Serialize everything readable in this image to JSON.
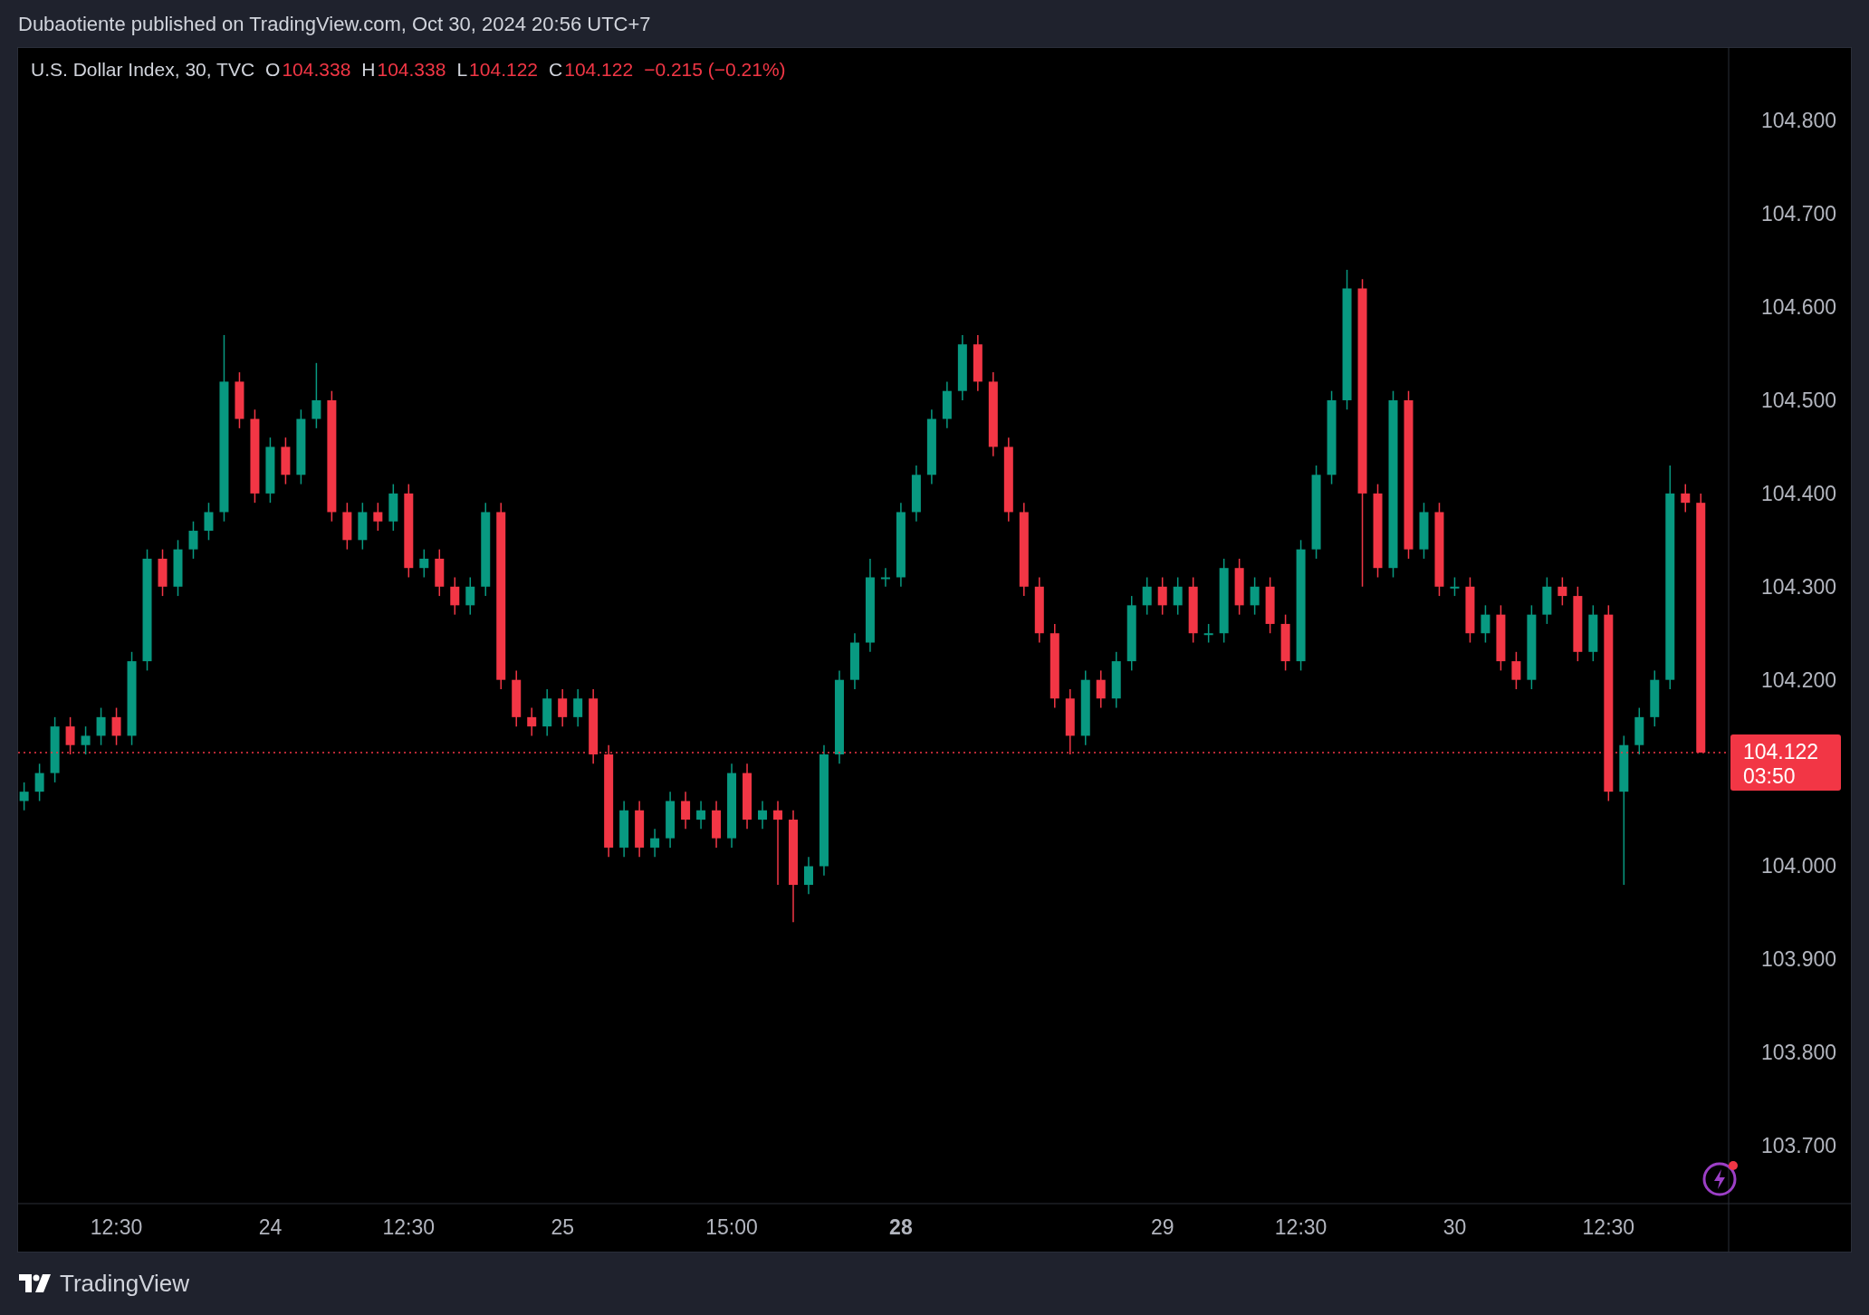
{
  "header": {
    "text": "Dubaotiente published on TradingView.com, Oct 30, 2024 20:56 UTC+7"
  },
  "chart": {
    "legend": {
      "symbol": "U.S. Dollar Index, 30, TVC",
      "fields": [
        {
          "label": "O",
          "value": "104.338"
        },
        {
          "label": "H",
          "value": "104.338"
        },
        {
          "label": "L",
          "value": "104.122"
        },
        {
          "label": "C",
          "value": "104.122"
        }
      ],
      "change": "−0.215 (−0.21%)"
    },
    "last_price": {
      "countdown": "03:50"
    },
    "bold_ticks": [
      false,
      false,
      false,
      false,
      false,
      true,
      false,
      false,
      false,
      false
    ],
    "chart_data": {
      "type": "candlestick",
      "ylim": [
        103.638,
        104.878
      ],
      "yticks": [
        {
          "value": 104.8,
          "label": "104.800"
        },
        {
          "value": 104.7,
          "label": "104.700"
        },
        {
          "value": 104.6,
          "label": "104.600"
        },
        {
          "value": 104.5,
          "label": "104.500"
        },
        {
          "value": 104.4,
          "label": "104.400"
        },
        {
          "value": 104.3,
          "label": "104.300"
        },
        {
          "value": 104.2,
          "label": "104.200"
        },
        {
          "value": 104.0,
          "label": "104.000"
        },
        {
          "value": 103.9,
          "label": "103.900"
        },
        {
          "value": 103.8,
          "label": "103.800"
        },
        {
          "value": 103.7,
          "label": "103.700"
        }
      ],
      "ref_lines": [
        {
          "axis": "y",
          "value": 104.122,
          "label": "104.122",
          "color": "#f23645"
        }
      ],
      "categories": [
        null,
        null,
        null,
        null,
        null,
        null,
        "12:30",
        null,
        null,
        null,
        null,
        null,
        null,
        null,
        null,
        null,
        "24",
        null,
        null,
        null,
        null,
        null,
        null,
        null,
        null,
        "12:30",
        null,
        null,
        null,
        null,
        null,
        null,
        null,
        null,
        null,
        "25",
        null,
        null,
        null,
        null,
        null,
        null,
        null,
        null,
        null,
        null,
        "15:00",
        null,
        null,
        null,
        null,
        null,
        null,
        null,
        null,
        null,
        null,
        "28",
        null,
        null,
        null,
        null,
        null,
        null,
        null,
        null,
        null,
        null,
        null,
        null,
        null,
        null,
        null,
        null,
        "29",
        null,
        null,
        null,
        null,
        null,
        null,
        null,
        null,
        "12:30",
        null,
        null,
        null,
        null,
        null,
        null,
        null,
        null,
        null,
        "30",
        null,
        null,
        null,
        null,
        null,
        null,
        null,
        null,
        null,
        "12:30",
        null,
        null,
        null,
        null,
        null,
        null
      ],
      "ohlc": [
        [
          104.07,
          104.09,
          104.06,
          104.08
        ],
        [
          104.08,
          104.11,
          104.07,
          104.1
        ],
        [
          104.1,
          104.16,
          104.09,
          104.15
        ],
        [
          104.15,
          104.16,
          104.12,
          104.13
        ],
        [
          104.13,
          104.15,
          104.12,
          104.14
        ],
        [
          104.14,
          104.17,
          104.13,
          104.16
        ],
        [
          104.16,
          104.17,
          104.13,
          104.14
        ],
        [
          104.14,
          104.23,
          104.13,
          104.22
        ],
        [
          104.22,
          104.34,
          104.21,
          104.33
        ],
        [
          104.33,
          104.34,
          104.29,
          104.3
        ],
        [
          104.3,
          104.35,
          104.29,
          104.34
        ],
        [
          104.34,
          104.37,
          104.33,
          104.36
        ],
        [
          104.36,
          104.39,
          104.35,
          104.38
        ],
        [
          104.38,
          104.57,
          104.37,
          104.52
        ],
        [
          104.52,
          104.53,
          104.47,
          104.48
        ],
        [
          104.48,
          104.49,
          104.39,
          104.4
        ],
        [
          104.4,
          104.46,
          104.39,
          104.45
        ],
        [
          104.45,
          104.46,
          104.41,
          104.42
        ],
        [
          104.42,
          104.49,
          104.41,
          104.48
        ],
        [
          104.48,
          104.54,
          104.47,
          104.5
        ],
        [
          104.5,
          104.51,
          104.37,
          104.38
        ],
        [
          104.38,
          104.39,
          104.34,
          104.35
        ],
        [
          104.35,
          104.39,
          104.34,
          104.38
        ],
        [
          104.38,
          104.39,
          104.36,
          104.37
        ],
        [
          104.37,
          104.41,
          104.36,
          104.4
        ],
        [
          104.4,
          104.41,
          104.31,
          104.32
        ],
        [
          104.32,
          104.34,
          104.31,
          104.33
        ],
        [
          104.33,
          104.34,
          104.29,
          104.3
        ],
        [
          104.3,
          104.31,
          104.27,
          104.28
        ],
        [
          104.28,
          104.31,
          104.27,
          104.3
        ],
        [
          104.3,
          104.39,
          104.29,
          104.38
        ],
        [
          104.38,
          104.39,
          104.19,
          104.2
        ],
        [
          104.2,
          104.21,
          104.15,
          104.16
        ],
        [
          104.16,
          104.17,
          104.14,
          104.15
        ],
        [
          104.15,
          104.19,
          104.14,
          104.18
        ],
        [
          104.18,
          104.19,
          104.15,
          104.16
        ],
        [
          104.16,
          104.19,
          104.15,
          104.18
        ],
        [
          104.18,
          104.19,
          104.11,
          104.12
        ],
        [
          104.12,
          104.13,
          104.01,
          104.02
        ],
        [
          104.02,
          104.07,
          104.01,
          104.06
        ],
        [
          104.06,
          104.07,
          104.01,
          104.02
        ],
        [
          104.02,
          104.04,
          104.01,
          104.03
        ],
        [
          104.03,
          104.08,
          104.02,
          104.07
        ],
        [
          104.07,
          104.08,
          104.04,
          104.05
        ],
        [
          104.05,
          104.07,
          104.04,
          104.06
        ],
        [
          104.06,
          104.07,
          104.02,
          104.03
        ],
        [
          104.03,
          104.11,
          104.02,
          104.1
        ],
        [
          104.1,
          104.11,
          104.04,
          104.05
        ],
        [
          104.05,
          104.07,
          104.04,
          104.06
        ],
        [
          104.06,
          104.07,
          103.98,
          104.05
        ],
        [
          104.05,
          104.06,
          103.94,
          103.98
        ],
        [
          103.98,
          104.01,
          103.97,
          104.0
        ],
        [
          104.0,
          104.13,
          103.99,
          104.12
        ],
        [
          104.12,
          104.21,
          104.11,
          104.2
        ],
        [
          104.2,
          104.25,
          104.19,
          104.24
        ],
        [
          104.24,
          104.33,
          104.23,
          104.31
        ],
        [
          104.31,
          104.32,
          104.3,
          104.31
        ],
        [
          104.31,
          104.39,
          104.3,
          104.38
        ],
        [
          104.38,
          104.43,
          104.37,
          104.42
        ],
        [
          104.42,
          104.49,
          104.41,
          104.48
        ],
        [
          104.48,
          104.52,
          104.47,
          104.51
        ],
        [
          104.51,
          104.57,
          104.5,
          104.56
        ],
        [
          104.56,
          104.57,
          104.51,
          104.52
        ],
        [
          104.52,
          104.53,
          104.44,
          104.45
        ],
        [
          104.45,
          104.46,
          104.37,
          104.38
        ],
        [
          104.38,
          104.39,
          104.29,
          104.3
        ],
        [
          104.3,
          104.31,
          104.24,
          104.25
        ],
        [
          104.25,
          104.26,
          104.17,
          104.18
        ],
        [
          104.18,
          104.19,
          104.12,
          104.14
        ],
        [
          104.14,
          104.21,
          104.13,
          104.2
        ],
        [
          104.2,
          104.21,
          104.17,
          104.18
        ],
        [
          104.18,
          104.23,
          104.17,
          104.22
        ],
        [
          104.22,
          104.29,
          104.21,
          104.28
        ],
        [
          104.28,
          104.31,
          104.27,
          104.3
        ],
        [
          104.3,
          104.31,
          104.27,
          104.28
        ],
        [
          104.28,
          104.31,
          104.27,
          104.3
        ],
        [
          104.3,
          104.31,
          104.24,
          104.25
        ],
        [
          104.25,
          104.26,
          104.24,
          104.25
        ],
        [
          104.25,
          104.33,
          104.24,
          104.32
        ],
        [
          104.32,
          104.33,
          104.27,
          104.28
        ],
        [
          104.28,
          104.31,
          104.27,
          104.3
        ],
        [
          104.3,
          104.31,
          104.25,
          104.26
        ],
        [
          104.26,
          104.27,
          104.21,
          104.22
        ],
        [
          104.22,
          104.35,
          104.21,
          104.34
        ],
        [
          104.34,
          104.43,
          104.33,
          104.42
        ],
        [
          104.42,
          104.51,
          104.41,
          104.5
        ],
        [
          104.5,
          104.64,
          104.49,
          104.62
        ],
        [
          104.62,
          104.63,
          104.3,
          104.4
        ],
        [
          104.4,
          104.41,
          104.31,
          104.32
        ],
        [
          104.32,
          104.51,
          104.31,
          104.5
        ],
        [
          104.5,
          104.51,
          104.33,
          104.34
        ],
        [
          104.34,
          104.39,
          104.33,
          104.38
        ],
        [
          104.38,
          104.39,
          104.29,
          104.3
        ],
        [
          104.3,
          104.31,
          104.29,
          104.3
        ],
        [
          104.3,
          104.31,
          104.24,
          104.25
        ],
        [
          104.25,
          104.28,
          104.24,
          104.27
        ],
        [
          104.27,
          104.28,
          104.21,
          104.22
        ],
        [
          104.22,
          104.23,
          104.19,
          104.2
        ],
        [
          104.2,
          104.28,
          104.19,
          104.27
        ],
        [
          104.27,
          104.31,
          104.26,
          104.3
        ],
        [
          104.3,
          104.31,
          104.28,
          104.29
        ],
        [
          104.29,
          104.3,
          104.22,
          104.23
        ],
        [
          104.23,
          104.28,
          104.22,
          104.27
        ],
        [
          104.27,
          104.28,
          104.07,
          104.08
        ],
        [
          104.08,
          104.14,
          103.98,
          104.13
        ],
        [
          104.13,
          104.17,
          104.12,
          104.16
        ],
        [
          104.16,
          104.21,
          104.15,
          104.2
        ],
        [
          104.2,
          104.43,
          104.19,
          104.4
        ],
        [
          104.4,
          104.41,
          104.38,
          104.39
        ],
        [
          104.39,
          104.4,
          104.122,
          104.122
        ]
      ]
    }
  },
  "footer": {
    "brand": "TradingView"
  }
}
